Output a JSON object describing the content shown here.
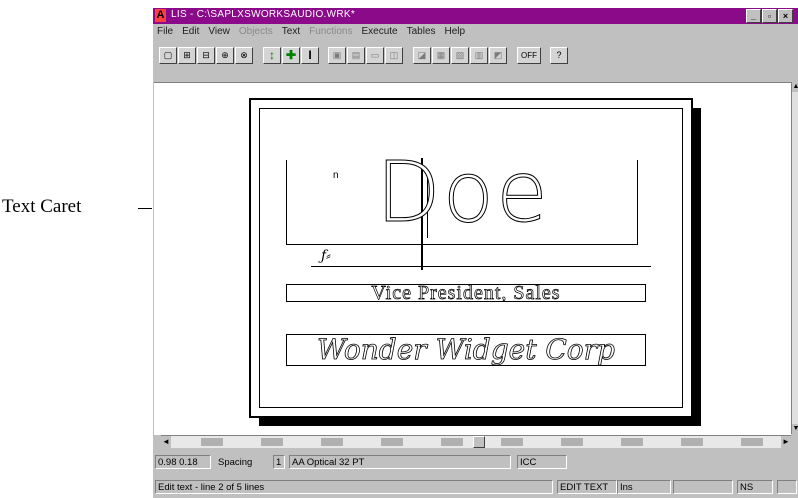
{
  "callout": {
    "label": "Text Caret"
  },
  "window": {
    "title": "LIS - C:\\SAPLXSWORKSAUDIO.WRK*",
    "controls": [
      "_",
      "▫",
      "×"
    ]
  },
  "menu": [
    "File",
    "Edit",
    "View",
    "Objects",
    "Text",
    "Functions",
    "Execute",
    "Tables",
    "Help"
  ],
  "toolbar": {
    "buttons": [
      "▢",
      "⊞",
      "⊟",
      "⊕",
      "⊗",
      "↕",
      "✚",
      "I",
      "▣",
      "▤",
      "▭",
      "◫",
      "◪",
      "▦",
      "▧",
      "▥",
      "◩",
      "OFF",
      "?"
    ]
  },
  "card": {
    "name": "Doe",
    "small_mark": "n",
    "squiggle": "ƒ⸗",
    "title": "Vice President, Sales",
    "company": "Wonder Widget Corp"
  },
  "status1": {
    "coords": "0.98 0.18",
    "spacing_label": "Spacing",
    "spacing_value": "1",
    "font": "AA Optical 32 PT",
    "extra": "ICC"
  },
  "status2": {
    "message": "Edit text - line 2 of 5 lines",
    "mode": "EDIT TEXT",
    "mode_extra": "Ins",
    "indicator": "NS"
  }
}
